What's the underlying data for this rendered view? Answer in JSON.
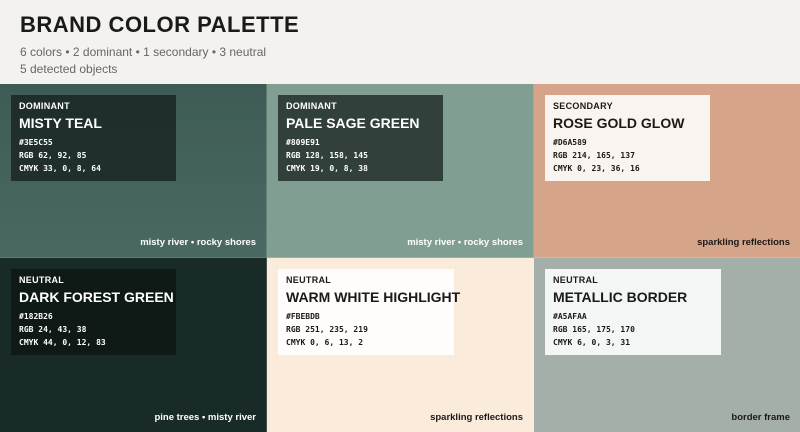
{
  "header": {
    "title": "BRAND COLOR PALETTE",
    "summary": "6 colors  •  2 dominant  •  1 secondary  •  3 neutral",
    "objects": "5 detected objects"
  },
  "swatches": [
    {
      "role": "DOMINANT",
      "name": "MISTY TEAL",
      "hex": "#3E5C55",
      "rgb": "RGB 62, 92, 85",
      "cmyk": "CMYK 33, 0, 8, 64",
      "caption": "misty river • rocky shores",
      "color": "#3e5c55"
    },
    {
      "role": "DOMINANT",
      "name": "PALE SAGE GREEN",
      "hex": "#809E91",
      "rgb": "RGB 128, 158, 145",
      "cmyk": "CMYK 19, 0, 8, 38",
      "caption": "misty river • rocky shores",
      "color": "#809e91"
    },
    {
      "role": "SECONDARY",
      "name": "ROSE GOLD GLOW",
      "hex": "#D6A589",
      "rgb": "RGB 214, 165, 137",
      "cmyk": "CMYK 0, 23, 36, 16",
      "caption": "sparkling reflections",
      "color": "#d6a589"
    },
    {
      "role": "NEUTRAL",
      "name": "DARK FOREST GREEN",
      "hex": "#182B26",
      "rgb": "RGB 24, 43, 38",
      "cmyk": "CMYK 44, 0, 12, 83",
      "caption": "pine trees • misty river",
      "color": "#182b26"
    },
    {
      "role": "NEUTRAL",
      "name": "WARM WHITE HIGHLIGHT",
      "hex": "#FBEBDB",
      "rgb": "RGB 251, 235, 219",
      "cmyk": "CMYK 0, 6, 13, 2",
      "caption": "sparkling reflections",
      "color": "#fbebdb"
    },
    {
      "role": "NEUTRAL",
      "name": "METALLIC BORDER",
      "hex": "#A5AFAA",
      "rgb": "RGB 165, 175, 170",
      "cmyk": "CMYK 6, 0, 3, 31",
      "caption": "border frame",
      "color": "#a5afaa"
    }
  ]
}
